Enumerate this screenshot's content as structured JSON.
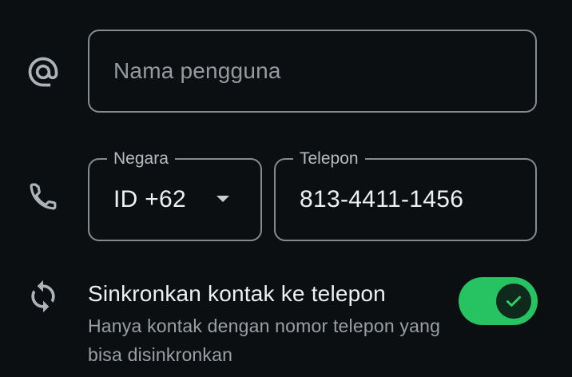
{
  "username": {
    "placeholder": "Nama pengguna",
    "icon": "at-sign-icon"
  },
  "phone": {
    "icon": "phone-icon",
    "country": {
      "label": "Negara",
      "value": "ID +62"
    },
    "number": {
      "label": "Telepon",
      "value": "813-4411-1456"
    }
  },
  "sync": {
    "icon": "sync-icon",
    "title": "Sinkronkan kontak ke telepon",
    "description": "Hanya kontak dengan nomor telepon yang bisa disinkronkan",
    "enabled": true
  },
  "colors": {
    "background": "#0b0f12",
    "accent": "#27c261",
    "outline": "#868b8f"
  }
}
